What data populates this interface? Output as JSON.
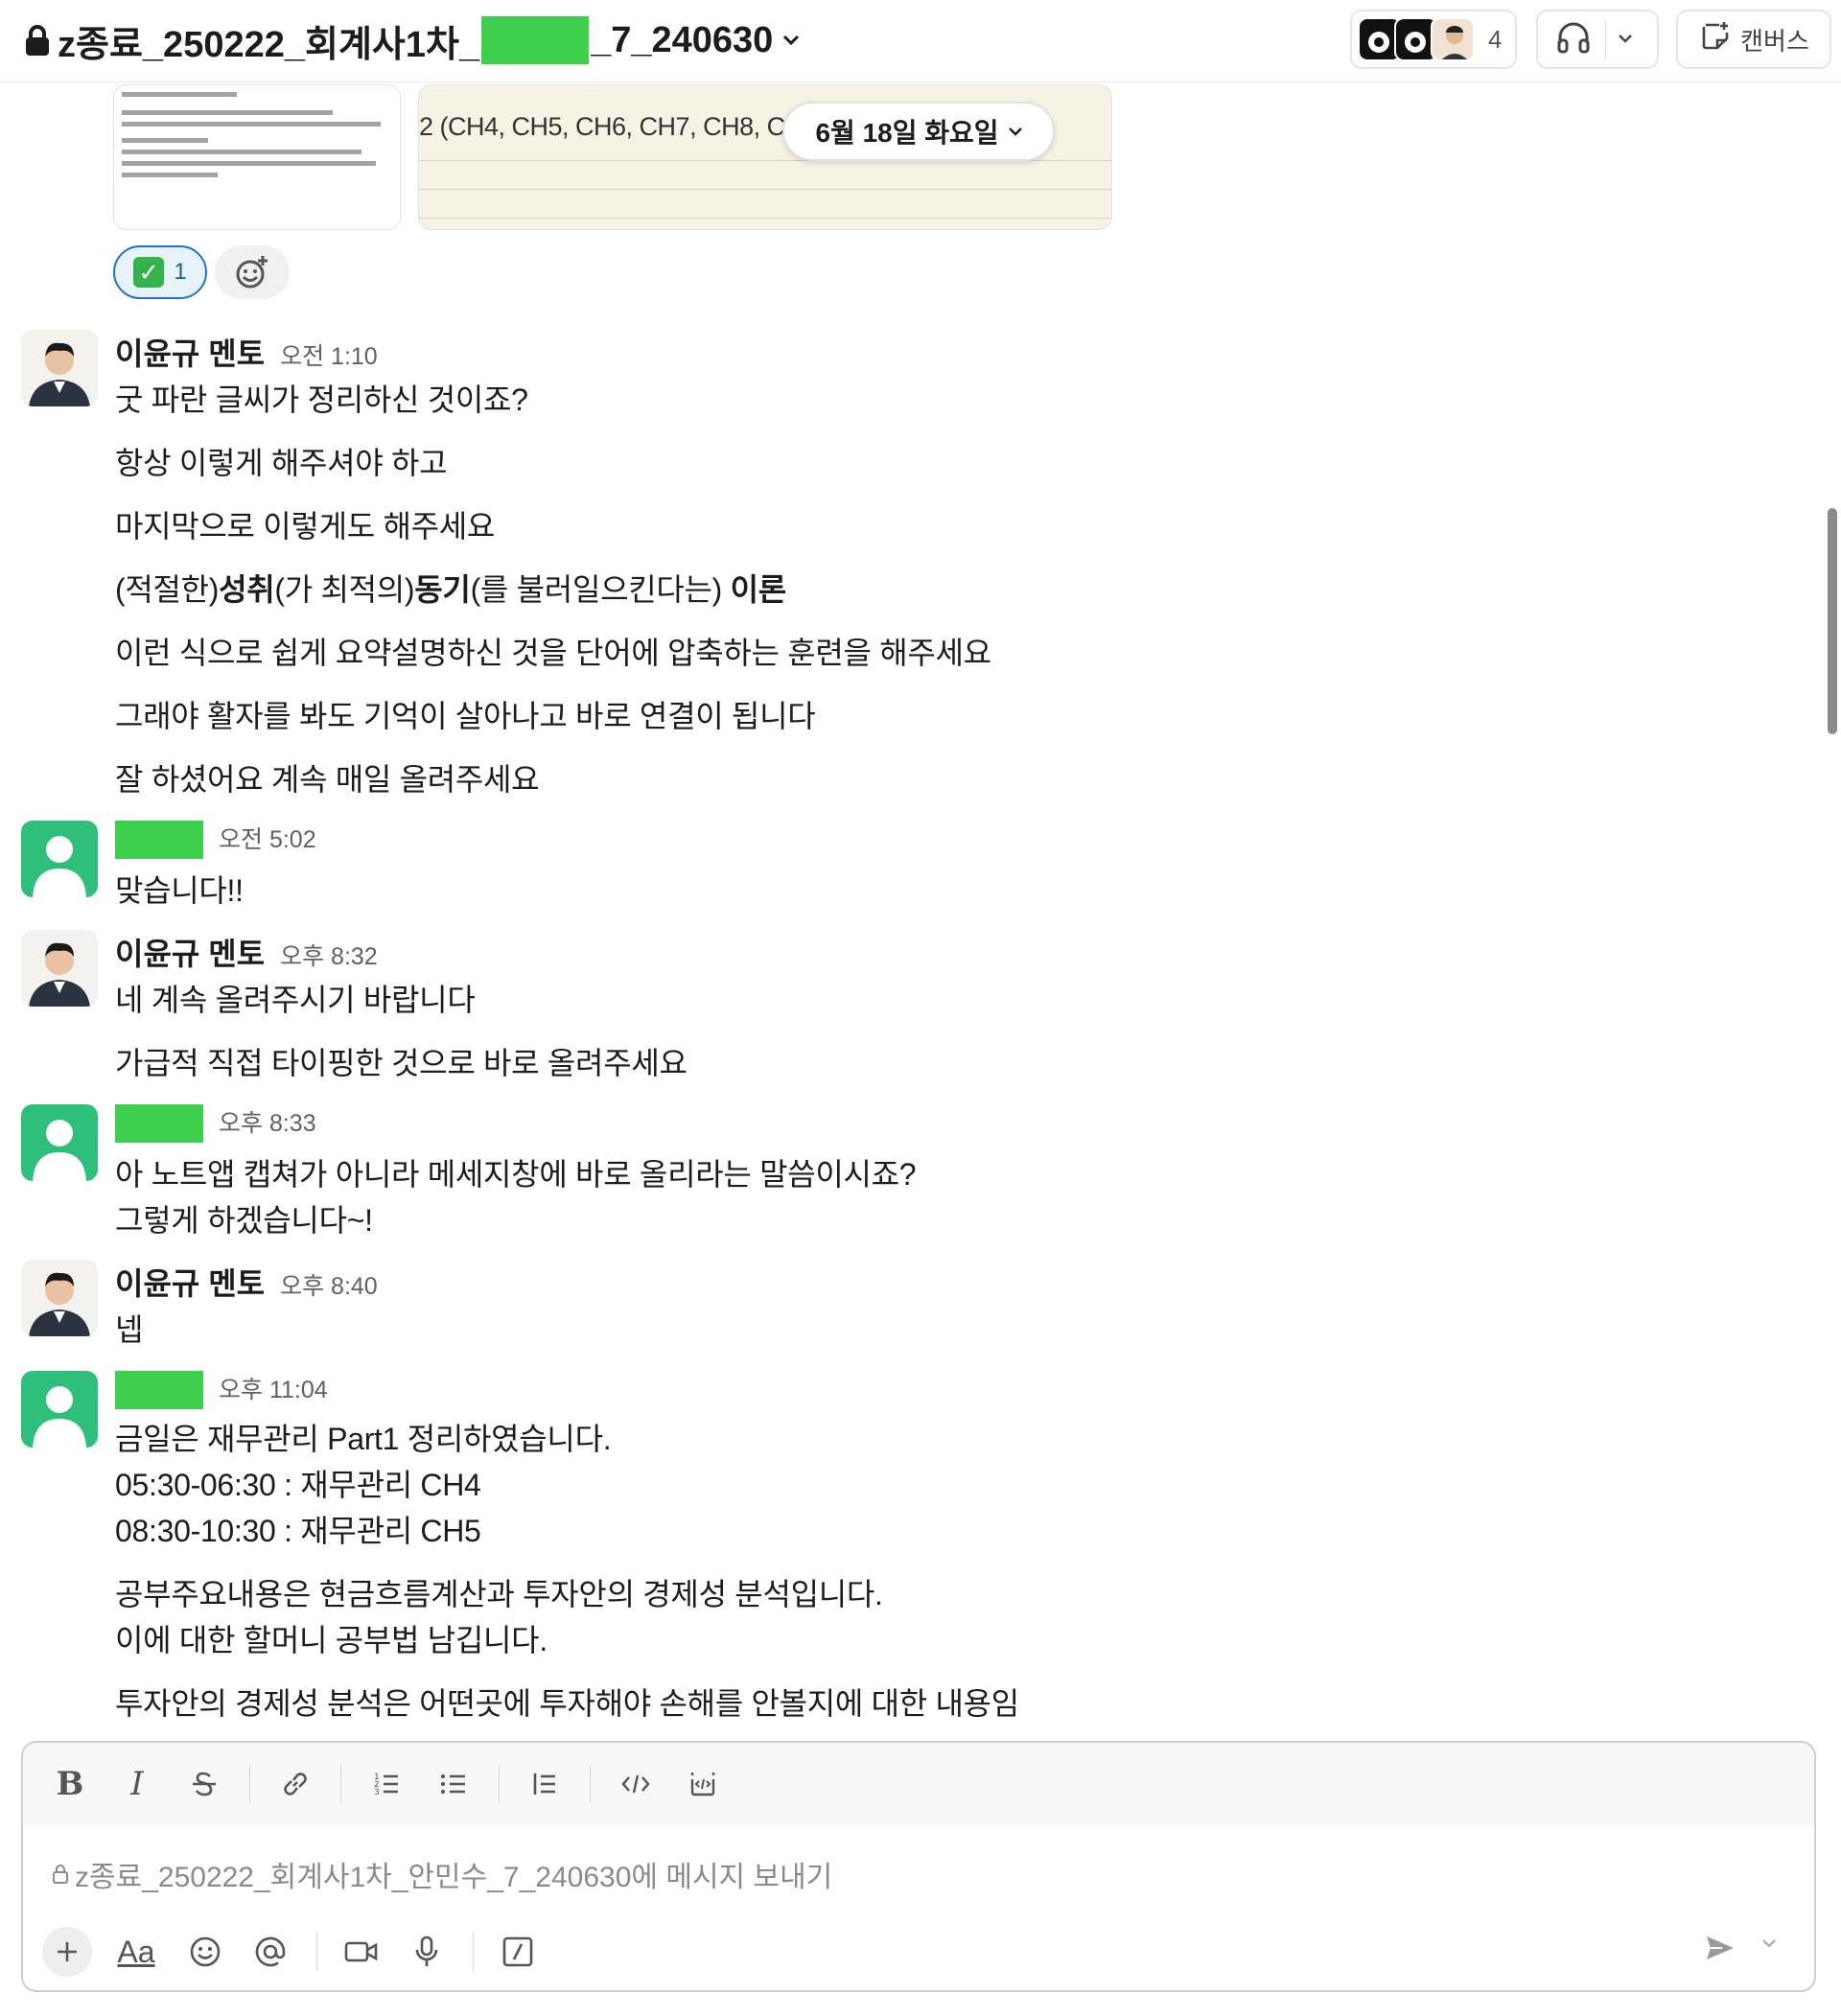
{
  "header": {
    "title_prefix": "z종료_250222_회계사1차_",
    "title_suffix": "_7_240630",
    "member_count": "4",
    "canvas_label": "캔버스"
  },
  "attachments": {
    "preview_text": "2 (CH4, CH5, CH6, CH7, CH8, C"
  },
  "date_divider": "6월 18일 화요일",
  "reaction": {
    "emoji": "✅",
    "count": "1"
  },
  "messages": [
    {
      "author": "이윤규 멘토",
      "time": "오전 1:10",
      "lines": [
        "굿 파란 글씨가 정리하신 것이죠?",
        "항상 이렇게 해주셔야 하고",
        "마지막으로 이렇게도 해주세요",
        "이런 식으로 쉽게 요약설명하신 것을 단어에 압축하는 훈련을 해주세요",
        "그래야 활자를 봐도 기억이 살아나고 바로 연결이 됩니다",
        "잘 하셨어요 계속 매일 올려주세요"
      ],
      "rich_line": {
        "p1": "(적절한)",
        "b1": "성취",
        "p2": "(가 최적의)",
        "b2": "동기",
        "p3": "(를 불러일으킨다는) ",
        "b3": "이론"
      }
    },
    {
      "author": "",
      "time": "오전 5:02",
      "lines": [
        "맞습니다!!"
      ]
    },
    {
      "author": "이윤규 멘토",
      "time": "오후 8:32",
      "lines": [
        "네 계속 올려주시기 바랍니다",
        "가급적 직접 타이핑한 것으로 바로 올려주세요"
      ]
    },
    {
      "author": "",
      "time": "오후 8:33",
      "lines": [
        "아 노트앱 캡쳐가 아니라 메세지창에 바로 올리라는 말씀이시죠?",
        "그렇게 하겠습니다~!"
      ]
    },
    {
      "author": "이윤규 멘토",
      "time": "오후 8:40",
      "lines": [
        "넵"
      ]
    },
    {
      "author": "",
      "time": "오후 11:04",
      "lines": [
        "금일은 재무관리 Part1 정리하였습니다.",
        "05:30-06:30 : 재무관리 CH4",
        "08:30-10:30 : 재무관리 CH5",
        "공부주요내용은 현금흐름계산과 투자안의 경제성 분석입니다.",
        "이에 대한 할머니 공부법 남깁니다.",
        "투자안의 경제성 분석은 어떤곳에 투자해야 손해를 안볼지에 대한 내용임"
      ]
    }
  ],
  "composer": {
    "placeholder": "z종료_250222_회계사1차_안민수_7_240630에 메시지 보내기",
    "bold": "B",
    "italic": "I",
    "format_label": "Aa"
  }
}
